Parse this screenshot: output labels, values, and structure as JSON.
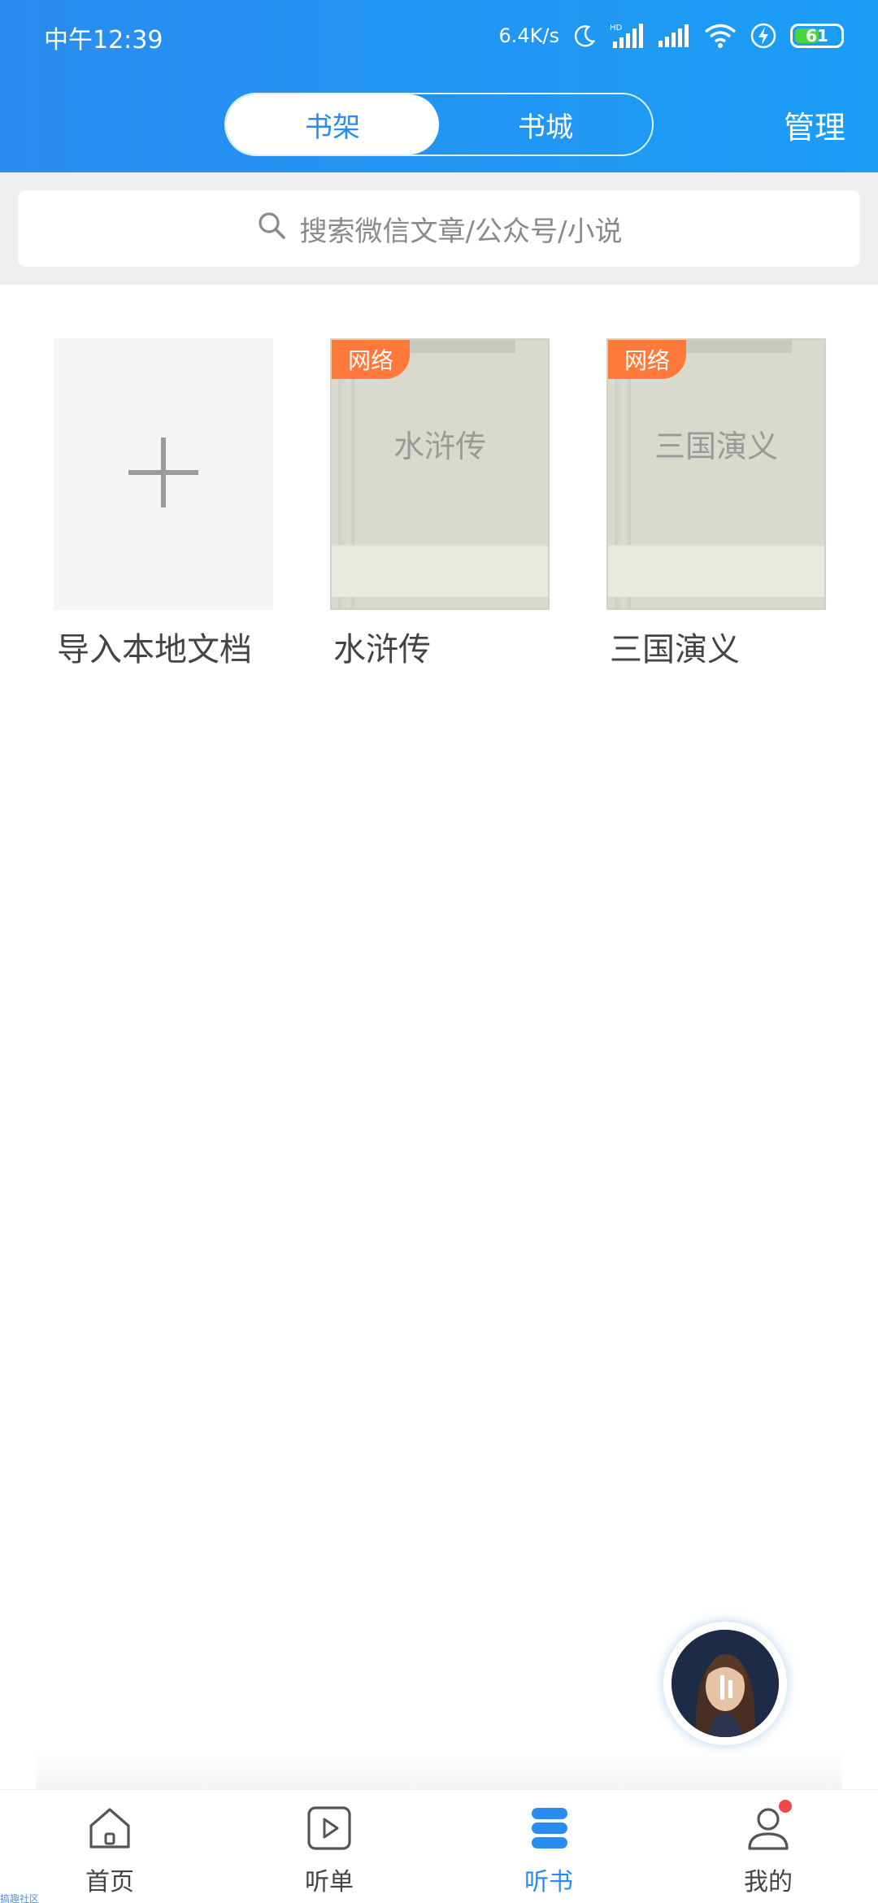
{
  "status_bar": {
    "time": "中午12:39",
    "net_speed": "6.4K/s",
    "battery": "61",
    "icons": [
      "moon-icon",
      "hd-signal-icon",
      "signal-icon",
      "wifi-icon",
      "charging-icon",
      "battery-icon"
    ]
  },
  "header": {
    "tabs": [
      {
        "label": "书架",
        "active": true
      },
      {
        "label": "书城",
        "active": false
      }
    ],
    "manage_label": "管理"
  },
  "search": {
    "placeholder": "搜索微信文章/公众号/小说",
    "icon": "search-icon"
  },
  "shelf": {
    "items": [
      {
        "type": "import",
        "label": "导入本地文档",
        "icon": "plus-icon"
      },
      {
        "type": "book",
        "tag": "网络",
        "cover_title": "水浒传",
        "label": "水浒传"
      },
      {
        "type": "book",
        "tag": "网络",
        "cover_title": "三国演义",
        "label": "三国演义"
      }
    ]
  },
  "bottom_nav": {
    "items": [
      {
        "label": "首页",
        "icon": "home-icon",
        "active": false
      },
      {
        "label": "听单",
        "icon": "play-list-icon",
        "active": false
      },
      {
        "label": "听书",
        "icon": "listen-book-icon",
        "active": true
      },
      {
        "label": "我的",
        "icon": "user-icon",
        "active": false,
        "badge": true
      }
    ]
  },
  "colors": {
    "primary": "#2a8cf0",
    "tag": "#ff7a3a",
    "badge": "#f04848"
  },
  "watermark": "搞趣社区"
}
